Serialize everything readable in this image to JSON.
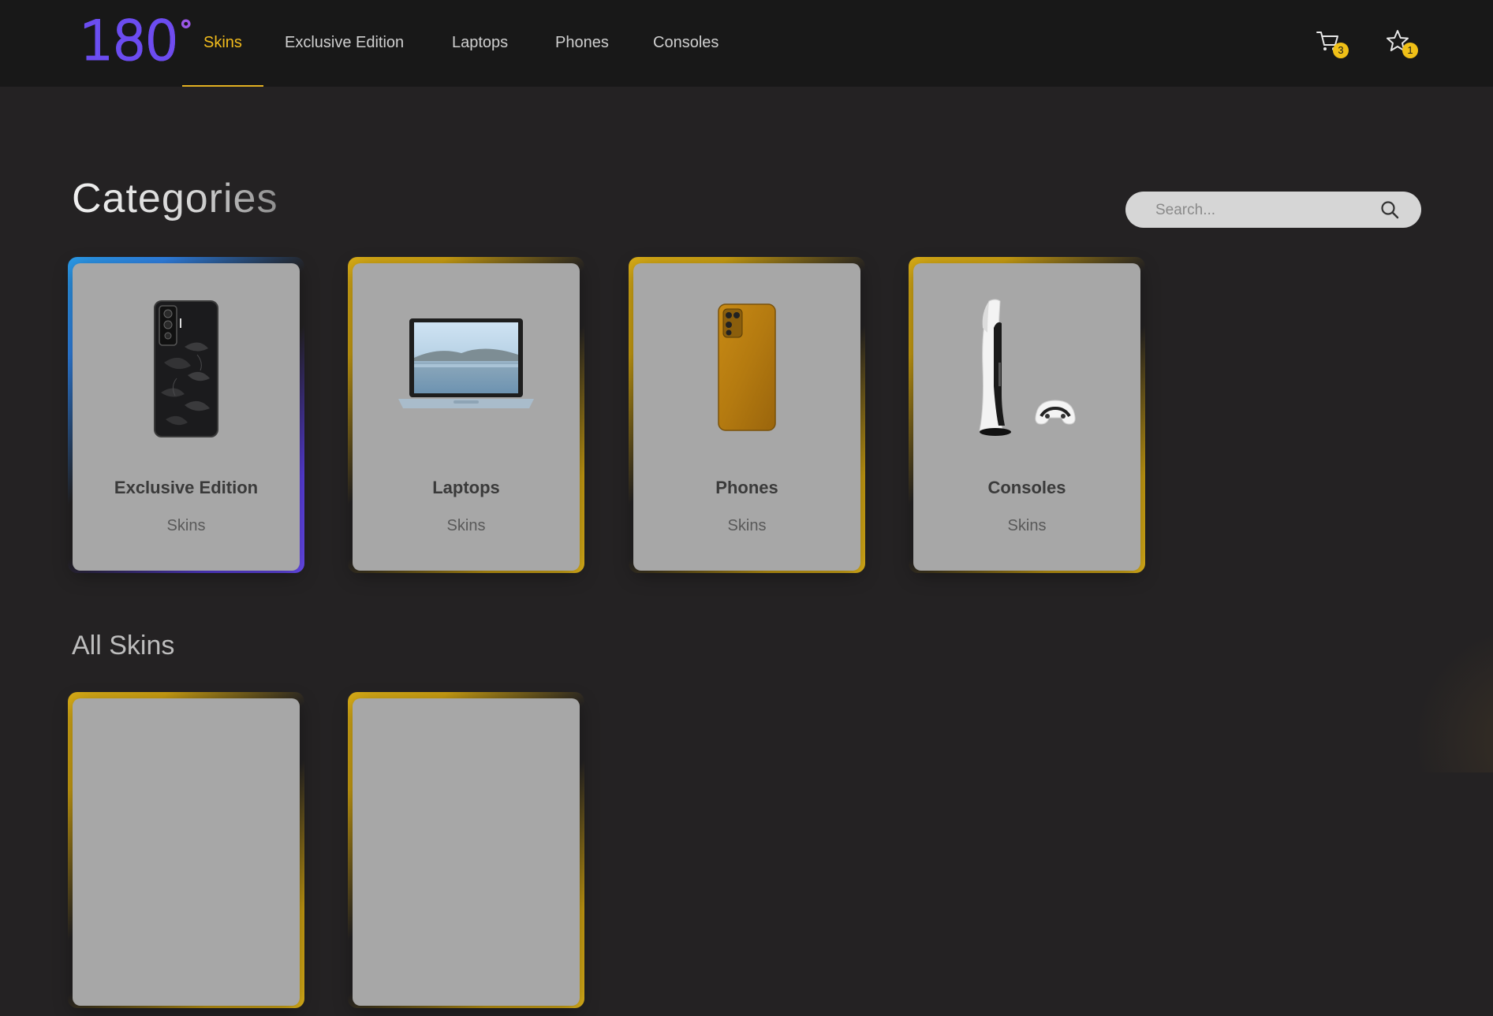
{
  "brand": {
    "logo_text": "180",
    "logo_degree": "°"
  },
  "nav": {
    "items": [
      {
        "label": "Skins",
        "active": true
      },
      {
        "label": "Exclusive Edition",
        "active": false
      },
      {
        "label": "Laptops",
        "active": false
      },
      {
        "label": "Phones",
        "active": false
      },
      {
        "label": "Consoles",
        "active": false
      }
    ],
    "cart_count": "3",
    "favorites_count": "1"
  },
  "categories": {
    "title": "Categories",
    "search": {
      "placeholder": "Search..."
    },
    "cards": [
      {
        "name": "Exclusive Edition",
        "subtitle": "Skins",
        "border": "blue",
        "image": "black-leaf-phone"
      },
      {
        "name": "Laptops",
        "subtitle": "Skins",
        "border": "gold",
        "image": "laptop"
      },
      {
        "name": "Phones",
        "subtitle": "Skins",
        "border": "gold",
        "image": "gold-phone"
      },
      {
        "name": "Consoles",
        "subtitle": "Skins",
        "border": "gold",
        "image": "ps5-console"
      }
    ]
  },
  "all_skins": {
    "title": "All Skins"
  },
  "colors": {
    "accent": "#f2bc1c",
    "background": "#242223",
    "topbar": "#181818",
    "card": "#a7a7a7",
    "badge": "#f0c017"
  }
}
